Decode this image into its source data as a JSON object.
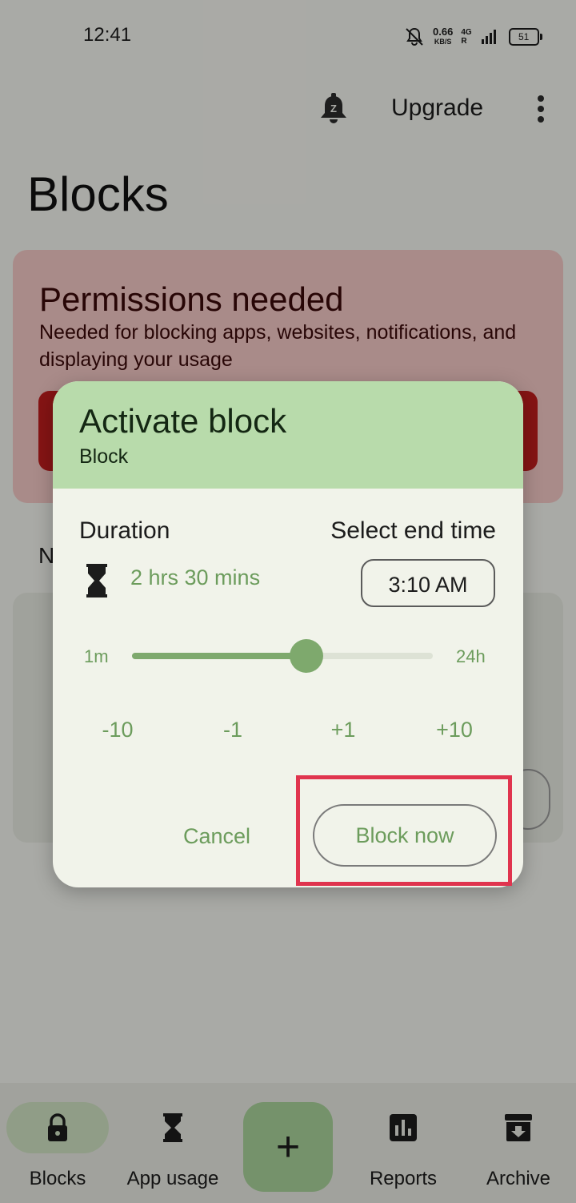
{
  "statusbar": {
    "time": "12:41",
    "speed": "0.66",
    "speed_unit": "KB/S",
    "network": "4G",
    "network_sub": "R",
    "battery": "51"
  },
  "topbar": {
    "upgrade_label": "Upgrade",
    "bell_letter": "Z"
  },
  "page": {
    "title": "Blocks"
  },
  "permissions": {
    "title": "Permissions needed",
    "description": "Needed for blocking apps, websites, notifications, and displaying your usage"
  },
  "section_letter": "N",
  "dialog": {
    "title": "Activate block",
    "subtitle": "Block",
    "duration_label": "Duration",
    "end_time_label": "Select end time",
    "duration_value": "2 hrs 30 mins",
    "end_time_value": "3:10 AM",
    "slider": {
      "min_label": "1m",
      "max_label": "24h",
      "fraction": 0.58
    },
    "steps": [
      "-10",
      "-1",
      "+1",
      "+10"
    ],
    "cancel_label": "Cancel",
    "block_now_label": "Block now"
  },
  "bottom_nav": {
    "items": [
      {
        "label": "Blocks",
        "icon": "lock-icon",
        "active": true
      },
      {
        "label": "App usage",
        "icon": "hourglass-icon",
        "active": false
      },
      {
        "label": "Reports",
        "icon": "bar-chart-icon",
        "active": false
      },
      {
        "label": "Archive",
        "icon": "archive-icon",
        "active": false
      }
    ],
    "fab_label": "+"
  },
  "colors": {
    "accent": "#7ea96d",
    "header": "#b8dbab",
    "permission_bg": "#f2c7c4",
    "highlight": "#e0344e"
  }
}
